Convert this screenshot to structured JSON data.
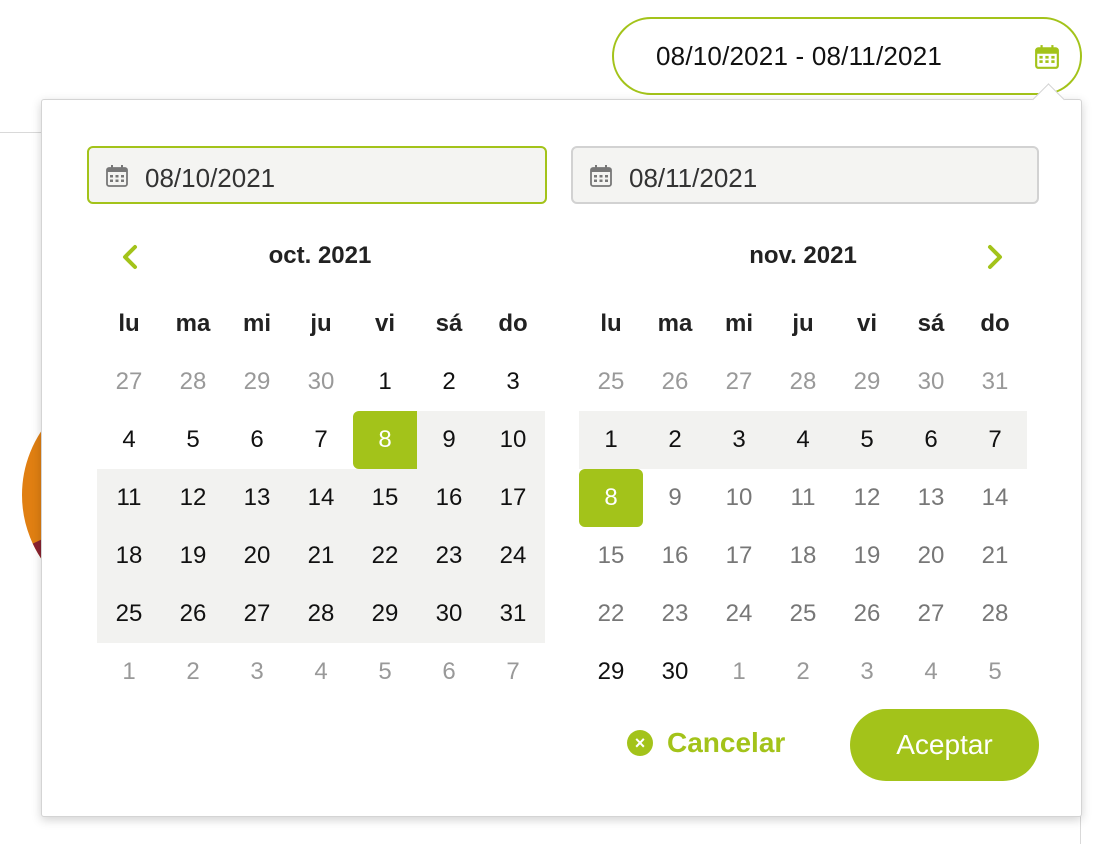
{
  "trigger": {
    "value": "08/10/2021 - 08/11/2021"
  },
  "inputs": {
    "start": "08/10/2021",
    "end": "08/11/2021"
  },
  "calendars": [
    {
      "title": "oct. 2021",
      "weekdays": [
        "lu",
        "ma",
        "mi",
        "ju",
        "vi",
        "sá",
        "do"
      ],
      "weeks": [
        [
          "27",
          "28",
          "29",
          "30",
          "1",
          "2",
          "3"
        ],
        [
          "4",
          "5",
          "6",
          "7",
          "8",
          "9",
          "10"
        ],
        [
          "11",
          "12",
          "13",
          "14",
          "15",
          "16",
          "17"
        ],
        [
          "18",
          "19",
          "20",
          "21",
          "22",
          "23",
          "24"
        ],
        [
          "25",
          "26",
          "27",
          "28",
          "29",
          "30",
          "31"
        ],
        [
          "1",
          "2",
          "3",
          "4",
          "5",
          "6",
          "7"
        ]
      ]
    },
    {
      "title": "nov. 2021",
      "weekdays": [
        "lu",
        "ma",
        "mi",
        "ju",
        "vi",
        "sá",
        "do"
      ],
      "weeks": [
        [
          "25",
          "26",
          "27",
          "28",
          "29",
          "30",
          "31"
        ],
        [
          "1",
          "2",
          "3",
          "4",
          "5",
          "6",
          "7"
        ],
        [
          "8",
          "9",
          "10",
          "11",
          "12",
          "13",
          "14"
        ],
        [
          "15",
          "16",
          "17",
          "18",
          "19",
          "20",
          "21"
        ],
        [
          "22",
          "23",
          "24",
          "25",
          "26",
          "27",
          "28"
        ],
        [
          "29",
          "30",
          "1",
          "2",
          "3",
          "4",
          "5"
        ]
      ]
    }
  ],
  "buttons": {
    "cancel": "Cancelar",
    "accept": "Aceptar",
    "cancel_icon": "×"
  },
  "colors": {
    "accent": "#a3c31a",
    "range_bg": "#f2f2f0"
  },
  "icons": {
    "trigger": "calendar-icon",
    "input": "calendar-icon",
    "prev": "chevron-left-icon",
    "next": "chevron-right-icon",
    "cancel": "close-circle-icon"
  }
}
